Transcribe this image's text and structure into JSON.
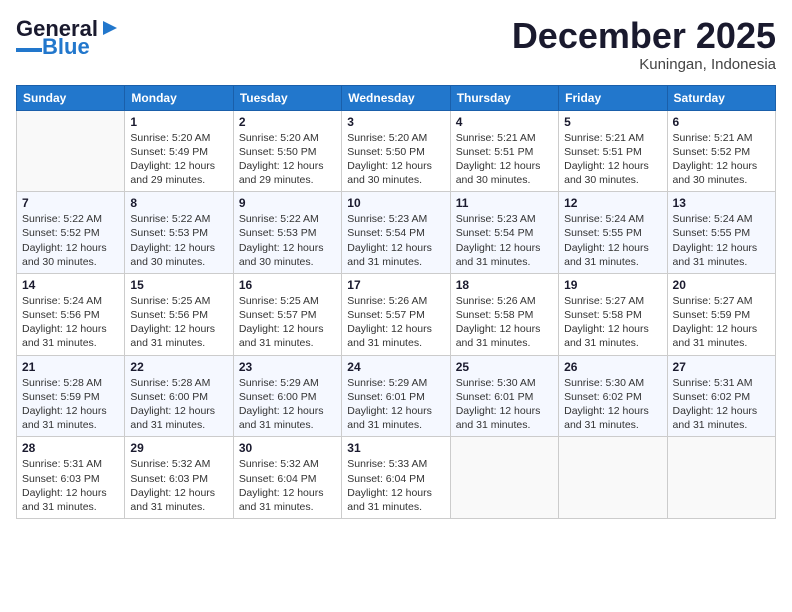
{
  "header": {
    "logo_line1": "General",
    "logo_line2": "Blue",
    "month_title": "December 2025",
    "location": "Kuningan, Indonesia"
  },
  "days_of_week": [
    "Sunday",
    "Monday",
    "Tuesday",
    "Wednesday",
    "Thursday",
    "Friday",
    "Saturday"
  ],
  "weeks": [
    [
      {
        "day": "",
        "info": ""
      },
      {
        "day": "1",
        "info": "Sunrise: 5:20 AM\nSunset: 5:49 PM\nDaylight: 12 hours\nand 29 minutes."
      },
      {
        "day": "2",
        "info": "Sunrise: 5:20 AM\nSunset: 5:50 PM\nDaylight: 12 hours\nand 29 minutes."
      },
      {
        "day": "3",
        "info": "Sunrise: 5:20 AM\nSunset: 5:50 PM\nDaylight: 12 hours\nand 30 minutes."
      },
      {
        "day": "4",
        "info": "Sunrise: 5:21 AM\nSunset: 5:51 PM\nDaylight: 12 hours\nand 30 minutes."
      },
      {
        "day": "5",
        "info": "Sunrise: 5:21 AM\nSunset: 5:51 PM\nDaylight: 12 hours\nand 30 minutes."
      },
      {
        "day": "6",
        "info": "Sunrise: 5:21 AM\nSunset: 5:52 PM\nDaylight: 12 hours\nand 30 minutes."
      }
    ],
    [
      {
        "day": "7",
        "info": "Sunrise: 5:22 AM\nSunset: 5:52 PM\nDaylight: 12 hours\nand 30 minutes."
      },
      {
        "day": "8",
        "info": "Sunrise: 5:22 AM\nSunset: 5:53 PM\nDaylight: 12 hours\nand 30 minutes."
      },
      {
        "day": "9",
        "info": "Sunrise: 5:22 AM\nSunset: 5:53 PM\nDaylight: 12 hours\nand 30 minutes."
      },
      {
        "day": "10",
        "info": "Sunrise: 5:23 AM\nSunset: 5:54 PM\nDaylight: 12 hours\nand 31 minutes."
      },
      {
        "day": "11",
        "info": "Sunrise: 5:23 AM\nSunset: 5:54 PM\nDaylight: 12 hours\nand 31 minutes."
      },
      {
        "day": "12",
        "info": "Sunrise: 5:24 AM\nSunset: 5:55 PM\nDaylight: 12 hours\nand 31 minutes."
      },
      {
        "day": "13",
        "info": "Sunrise: 5:24 AM\nSunset: 5:55 PM\nDaylight: 12 hours\nand 31 minutes."
      }
    ],
    [
      {
        "day": "14",
        "info": "Sunrise: 5:24 AM\nSunset: 5:56 PM\nDaylight: 12 hours\nand 31 minutes."
      },
      {
        "day": "15",
        "info": "Sunrise: 5:25 AM\nSunset: 5:56 PM\nDaylight: 12 hours\nand 31 minutes."
      },
      {
        "day": "16",
        "info": "Sunrise: 5:25 AM\nSunset: 5:57 PM\nDaylight: 12 hours\nand 31 minutes."
      },
      {
        "day": "17",
        "info": "Sunrise: 5:26 AM\nSunset: 5:57 PM\nDaylight: 12 hours\nand 31 minutes."
      },
      {
        "day": "18",
        "info": "Sunrise: 5:26 AM\nSunset: 5:58 PM\nDaylight: 12 hours\nand 31 minutes."
      },
      {
        "day": "19",
        "info": "Sunrise: 5:27 AM\nSunset: 5:58 PM\nDaylight: 12 hours\nand 31 minutes."
      },
      {
        "day": "20",
        "info": "Sunrise: 5:27 AM\nSunset: 5:59 PM\nDaylight: 12 hours\nand 31 minutes."
      }
    ],
    [
      {
        "day": "21",
        "info": "Sunrise: 5:28 AM\nSunset: 5:59 PM\nDaylight: 12 hours\nand 31 minutes."
      },
      {
        "day": "22",
        "info": "Sunrise: 5:28 AM\nSunset: 6:00 PM\nDaylight: 12 hours\nand 31 minutes."
      },
      {
        "day": "23",
        "info": "Sunrise: 5:29 AM\nSunset: 6:00 PM\nDaylight: 12 hours\nand 31 minutes."
      },
      {
        "day": "24",
        "info": "Sunrise: 5:29 AM\nSunset: 6:01 PM\nDaylight: 12 hours\nand 31 minutes."
      },
      {
        "day": "25",
        "info": "Sunrise: 5:30 AM\nSunset: 6:01 PM\nDaylight: 12 hours\nand 31 minutes."
      },
      {
        "day": "26",
        "info": "Sunrise: 5:30 AM\nSunset: 6:02 PM\nDaylight: 12 hours\nand 31 minutes."
      },
      {
        "day": "27",
        "info": "Sunrise: 5:31 AM\nSunset: 6:02 PM\nDaylight: 12 hours\nand 31 minutes."
      }
    ],
    [
      {
        "day": "28",
        "info": "Sunrise: 5:31 AM\nSunset: 6:03 PM\nDaylight: 12 hours\nand 31 minutes."
      },
      {
        "day": "29",
        "info": "Sunrise: 5:32 AM\nSunset: 6:03 PM\nDaylight: 12 hours\nand 31 minutes."
      },
      {
        "day": "30",
        "info": "Sunrise: 5:32 AM\nSunset: 6:04 PM\nDaylight: 12 hours\nand 31 minutes."
      },
      {
        "day": "31",
        "info": "Sunrise: 5:33 AM\nSunset: 6:04 PM\nDaylight: 12 hours\nand 31 minutes."
      },
      {
        "day": "",
        "info": ""
      },
      {
        "day": "",
        "info": ""
      },
      {
        "day": "",
        "info": ""
      }
    ]
  ]
}
